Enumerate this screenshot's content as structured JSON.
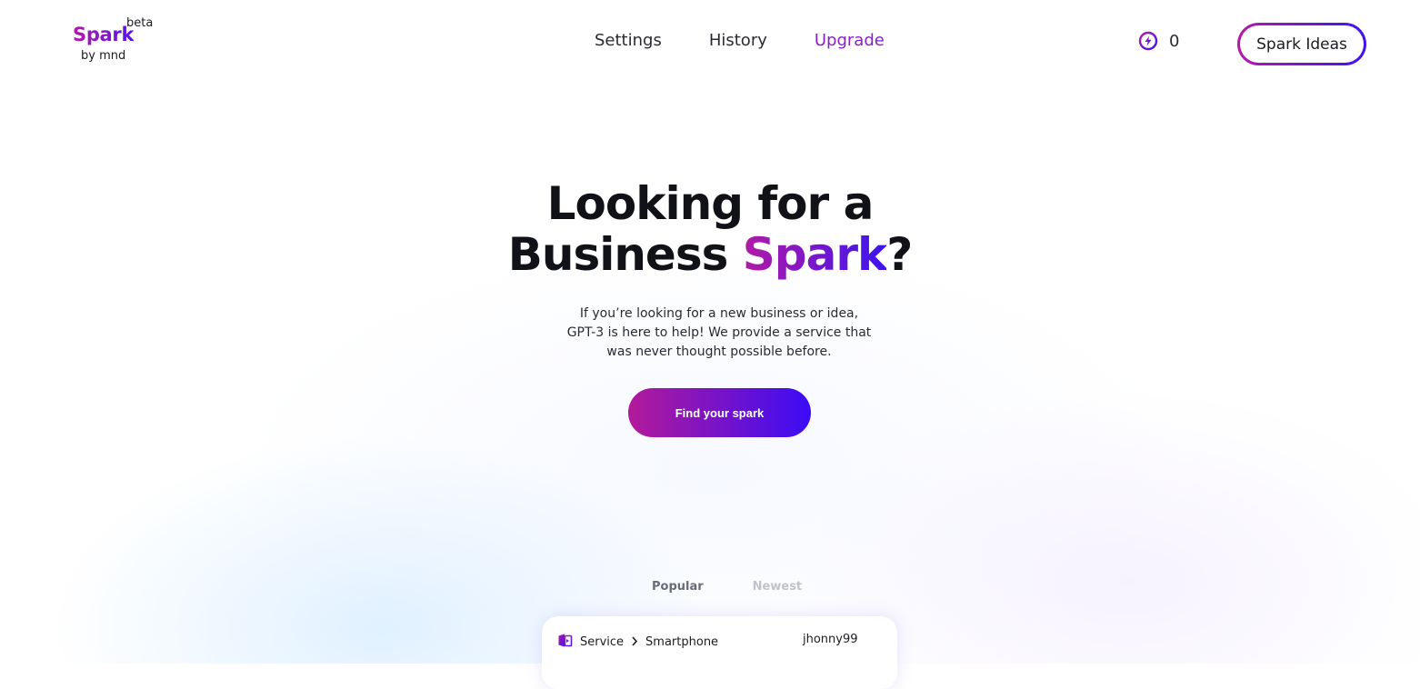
{
  "brand": {
    "name": "Spark",
    "badge": "beta",
    "byline": "by mnd"
  },
  "nav": {
    "settings": "Settings",
    "history": "History",
    "upgrade": "Upgrade"
  },
  "credits": {
    "count": "0",
    "icon": "lightning-coin-icon"
  },
  "header_cta": "Spark Ideas",
  "hero": {
    "title_line1": "Looking for a",
    "title_line2_prefix": "Business ",
    "title_line2_highlight": "Spark",
    "title_line2_suffix": "?",
    "subtitle_line1": "If you’re looking for a new business or idea,",
    "subtitle_line2": "GPT-3 is here to help! We provide a service that",
    "subtitle_line3": "was never thought possible before.",
    "button": "Find your spark"
  },
  "tabs": {
    "popular": "Popular",
    "newest": "Newest",
    "active": "popular"
  },
  "idea_card": {
    "category": "Service",
    "subcategory": "Smartphone",
    "author": "jhonny99"
  },
  "colors": {
    "gradient_start": "#b31aa5",
    "gradient_end": "#3d14f0",
    "active_nav": "#8a1fc8"
  }
}
